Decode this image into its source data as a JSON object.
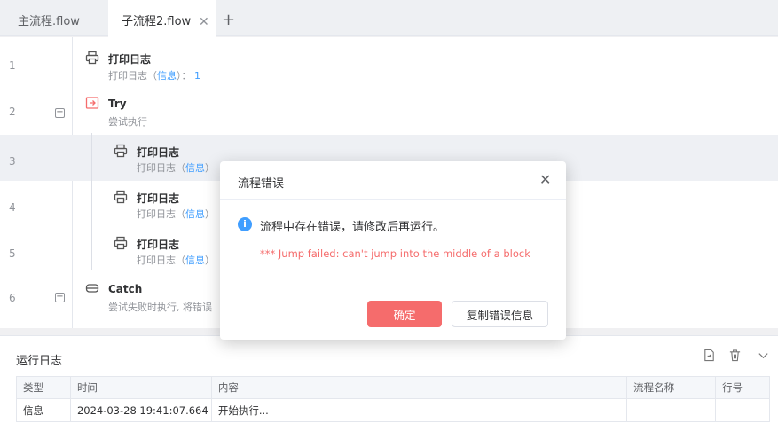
{
  "tabs": [
    {
      "label": "主流程.flow"
    },
    {
      "label": "子流程2.flow"
    }
  ],
  "editor": {
    "rows": [
      {
        "line": "1",
        "title": "打印日志",
        "sub_pre": "打印日志（",
        "sub_hl": "信息",
        "sub_post": "）：",
        "sub_num": "1"
      },
      {
        "line": "2",
        "title": "Try",
        "sub": "尝试执行"
      },
      {
        "line": "3",
        "title": "打印日志",
        "sub_pre": "打印日志（",
        "sub_hl": "信息",
        "sub_post": "）"
      },
      {
        "line": "4",
        "title": "打印日志",
        "sub_pre": "打印日志（",
        "sub_hl": "信息",
        "sub_post": "）"
      },
      {
        "line": "5",
        "title": "打印日志",
        "sub_pre": "打印日志（",
        "sub_hl": "信息",
        "sub_post": "）"
      },
      {
        "line": "6",
        "title": "Catch",
        "sub": "尝试失败时执行, 将错误"
      }
    ]
  },
  "log": {
    "title": "运行日志",
    "columns": [
      "类型",
      "时间",
      "内容",
      "流程名称",
      "行号"
    ],
    "rows": [
      {
        "type": "信息",
        "time": "2024-03-28 19:41:07.664",
        "content": "开始执行...",
        "flow": "",
        "line": ""
      }
    ]
  },
  "dialog": {
    "title": "流程错误",
    "message": "流程中存在错误，请修改后再运行。",
    "error": "*** Jump failed: can't jump into the middle of a block",
    "ok_label": "确定",
    "copy_label": "复制错误信息"
  },
  "colors": {
    "accent": "#409eff",
    "danger": "#f56c6c",
    "highlight_row": "#eef0f4"
  }
}
